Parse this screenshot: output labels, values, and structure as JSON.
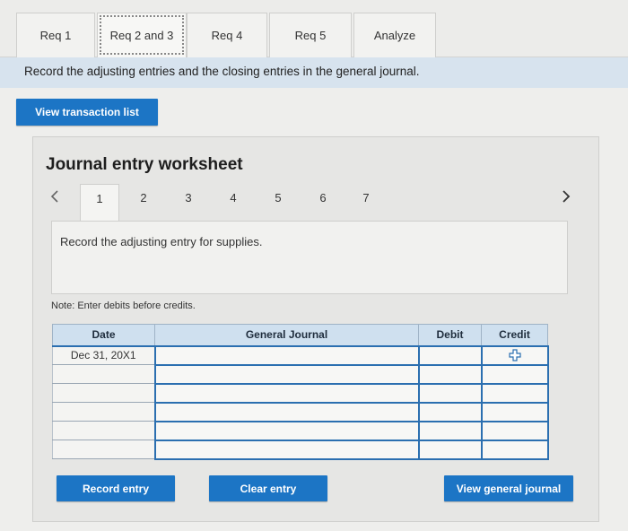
{
  "tabs": [
    {
      "label": "Req 1"
    },
    {
      "label": "Req 2 and 3"
    },
    {
      "label": "Req 4"
    },
    {
      "label": "Req 5"
    },
    {
      "label": "Analyze"
    }
  ],
  "instruction": "Record the adjusting entries and the closing entries in the general journal.",
  "view_transaction_label": "View transaction list",
  "worksheet": {
    "title": "Journal entry worksheet",
    "pages": [
      "1",
      "2",
      "3",
      "4",
      "5",
      "6",
      "7"
    ],
    "active_page": "1",
    "prompt": "Record the adjusting entry for supplies.",
    "note": "Note: Enter debits before credits."
  },
  "journal": {
    "headers": {
      "date": "Date",
      "account": "General Journal",
      "debit": "Debit",
      "credit": "Credit"
    },
    "first_date": "Dec 31, 20X1"
  },
  "buttons": {
    "record": "Record entry",
    "clear": "Clear entry",
    "view_journal": "View general journal"
  },
  "colors": {
    "accent": "#1c75c5",
    "header_bg": "#cfe0ef",
    "instruction_bg": "#d7e3ee"
  }
}
